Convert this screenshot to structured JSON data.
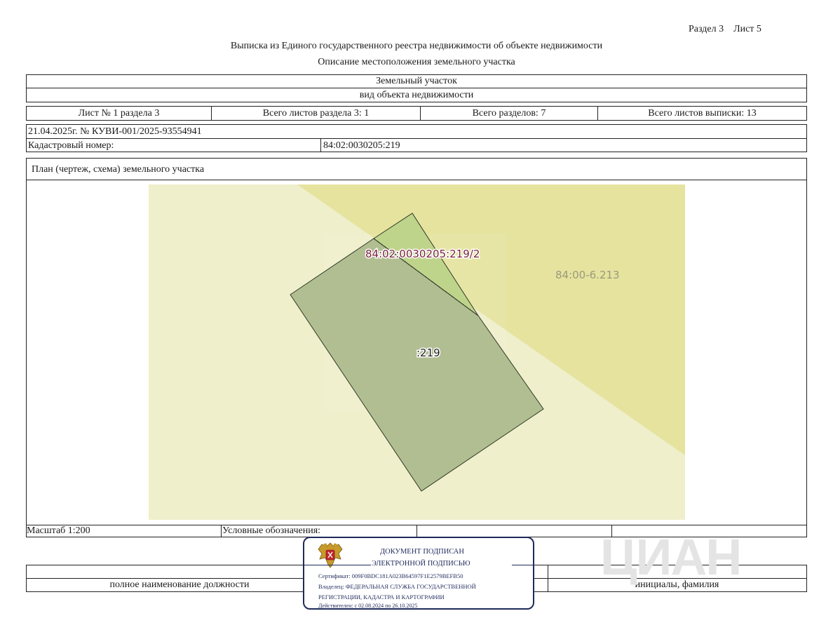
{
  "header": {
    "section_sheet": "Раздел 3    Лист 5",
    "title": "Выписка из Единого государственного реестра недвижимости об объекте недвижимости",
    "subtitle": "Описание местоположения земельного участка"
  },
  "object": {
    "type_value": "Земельный участок",
    "type_caption": "вид объекта недвижимости"
  },
  "sheets": {
    "sheet_no": "Лист № 1 раздела 3",
    "sheets_in_section": "Всего листов раздела 3: 1",
    "sections_total": "Всего разделов: 7",
    "sheets_total": "Всего листов выписки: 13"
  },
  "record": {
    "date_number": "21.04.2025г. № КУВИ-001/2025-93554941",
    "cadastral_label": "Кадастровый номер:",
    "cadastral_value": "84:02:0030205:219"
  },
  "plan": {
    "title": "План (чертеж, схема) земельного участка",
    "labels": {
      "parcel_part": "84:02:0030205:219/2",
      "zone": "84:00-6.213",
      "parcel": ":219"
    },
    "colors": {
      "background": "#efefcc",
      "zone": "#e6e39f",
      "parcel": "#b1be92",
      "part": "#bfd48b",
      "part_label": "#7a1f3d",
      "zone_label": "#9a9a7a"
    }
  },
  "legend": {
    "scale": "Масштаб 1:200",
    "symbols_label": "Условные обозначения:"
  },
  "signature": {
    "position_caption": "полное наименование должности",
    "name_caption": "инициалы, фамилия"
  },
  "stamp": {
    "line1": "ДОКУМЕНТ ПОДПИСАН",
    "line2": "ЭЛЕКТРОННОЙ ПОДПИСЬЮ",
    "certificate": "Сертификат: 009F0BDC181A023B64597F1E2579BEFB50",
    "owner1": "Владелец: ФЕДЕРАЛЬНАЯ СЛУЖБА ГОСУДАРСТВЕННОЙ",
    "owner2": "РЕГИСТРАЦИИ, КАДАСТРА И КАРТОГРАФИИ",
    "validity": "Действителен: с 02.08.2024 по 26.10.2025",
    "emblem_icon": "coat-of-arms-icon"
  }
}
